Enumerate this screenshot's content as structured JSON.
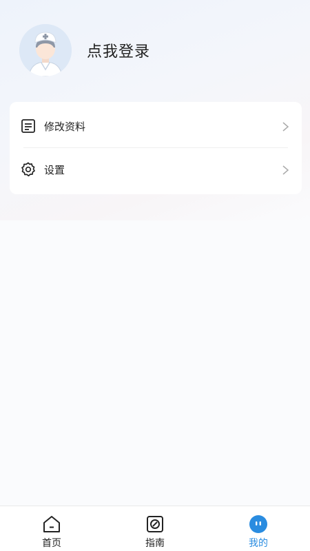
{
  "profile": {
    "login_text": "点我登录",
    "avatar_icon": "doctor-avatar-icon"
  },
  "menu": {
    "items": [
      {
        "label": "修改资料",
        "icon": "document-icon"
      },
      {
        "label": "设置",
        "icon": "gear-icon"
      }
    ]
  },
  "tabbar": {
    "tabs": [
      {
        "label": "首页",
        "icon": "home-icon",
        "active": false
      },
      {
        "label": "指南",
        "icon": "guide-icon",
        "active": false
      },
      {
        "label": "我的",
        "icon": "profile-face-icon",
        "active": true
      }
    ]
  },
  "colors": {
    "accent": "#2a8ce0",
    "text": "#222222",
    "card": "#ffffff"
  }
}
